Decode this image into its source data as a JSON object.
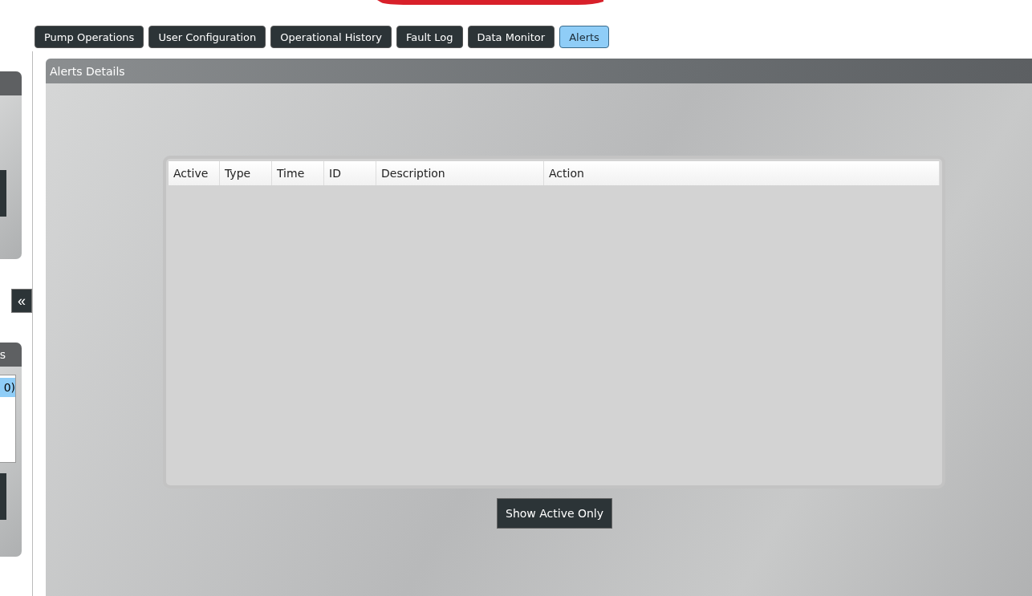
{
  "tabs": [
    {
      "label": "Pump Operations",
      "selected": false
    },
    {
      "label": "User Configuration",
      "selected": false
    },
    {
      "label": "Operational History",
      "selected": false
    },
    {
      "label": "Fault Log",
      "selected": false
    },
    {
      "label": "Data Monitor",
      "selected": false
    },
    {
      "label": "Alerts",
      "selected": true
    }
  ],
  "sidebar": {
    "collapse_button": "«",
    "lower_panel": {
      "title": "s",
      "items": [
        {
          "label": "0)",
          "selected": true
        }
      ]
    }
  },
  "alerts_panel": {
    "title": "Alerts Details",
    "table": {
      "columns": [
        "Active",
        "Type",
        "Time",
        "ID",
        "Description",
        "Action"
      ]
    },
    "button": "Show Active Only"
  }
}
